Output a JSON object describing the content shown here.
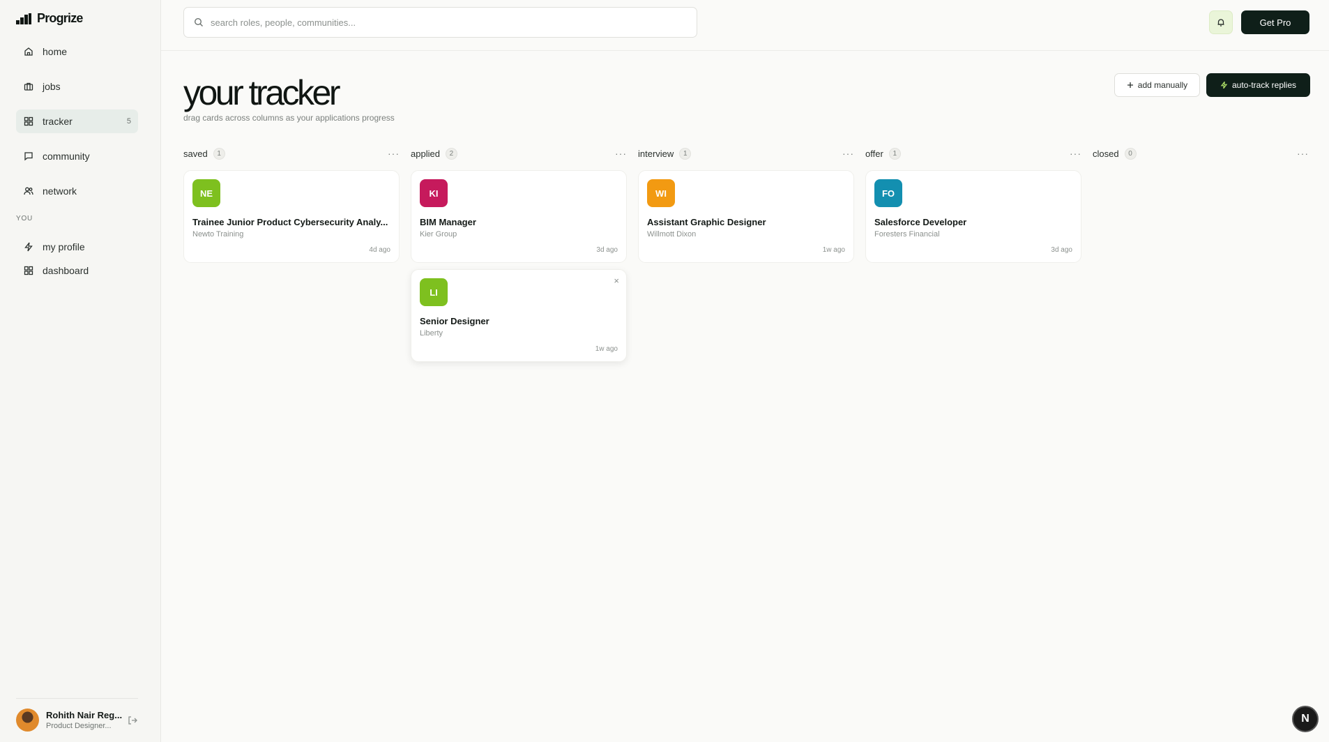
{
  "brand": {
    "name": "Progrize"
  },
  "sidebar": {
    "items": [
      {
        "label": "home",
        "icon": "home-icon"
      },
      {
        "label": "jobs",
        "icon": "briefcase-icon"
      },
      {
        "label": "tracker",
        "icon": "grid-icon",
        "count": "5",
        "active": true
      },
      {
        "label": "community",
        "icon": "chat-icon"
      },
      {
        "label": "network",
        "icon": "people-icon"
      }
    ],
    "section_label": "YOU",
    "you_items": [
      {
        "label": "my profile",
        "icon": "bolt-icon"
      },
      {
        "label": "dashboard",
        "icon": "grid-icon"
      }
    ],
    "user": {
      "name": "Rohith Nair Reg...",
      "role": "Product Designer..."
    }
  },
  "topbar": {
    "search_placeholder": "search roles, people, communities...",
    "get_pro": "Get Pro"
  },
  "header": {
    "title": "your tracker",
    "subtitle": "drag cards across columns as your applications progress",
    "add_manually": "add manually",
    "auto_track": "auto-track replies"
  },
  "columns": [
    {
      "title": "saved",
      "count": "1",
      "more": "···",
      "cards": [
        {
          "initials": "NE",
          "title": "Trainee Junior Product Cybersecurity Analy...",
          "company": "Newto Training",
          "time": "4d ago"
        }
      ]
    },
    {
      "title": "applied",
      "count": "2",
      "more": "···",
      "cards": [
        {
          "initials": "KI",
          "title": "BIM Manager",
          "company": "Kier Group",
          "time": "3d ago"
        },
        {
          "initials": "LI",
          "title": "Senior Designer",
          "company": "Liberty",
          "time": "1w ago"
        }
      ]
    },
    {
      "title": "interview",
      "count": "1",
      "more": "···",
      "cards": [
        {
          "initials": "WI",
          "title": "Assistant Graphic Designer",
          "company": "Willmott Dixon",
          "time": "1w ago"
        }
      ]
    },
    {
      "title": "offer",
      "count": "1",
      "more": "···",
      "cards": [
        {
          "initials": "FO",
          "title": "Salesforce Developer",
          "company": "Foresters Financial",
          "time": "3d ago"
        }
      ]
    },
    {
      "title": "closed",
      "count": "0",
      "more": "···",
      "cards": []
    }
  ],
  "colors": {
    "accent_dark": "#0f1f19",
    "logo_ne": "#7ec01f",
    "logo_ki": "#c61a5c",
    "logo_li": "#7ec01f",
    "logo_wi": "#f29a12",
    "logo_fo": "#138fb0"
  },
  "floating_badge": "N",
  "close_glyph": "×"
}
